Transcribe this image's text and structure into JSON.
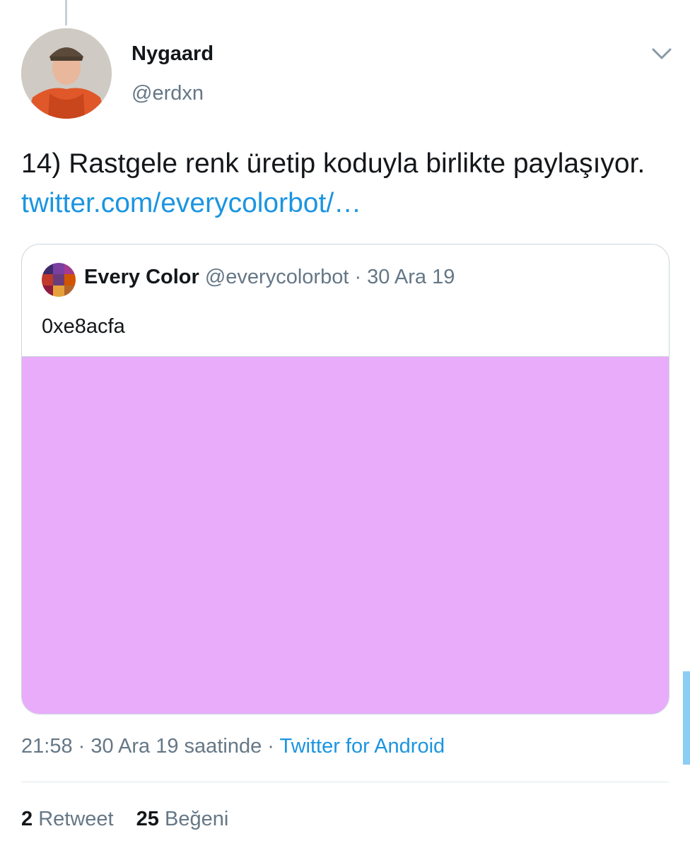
{
  "tweet": {
    "author": {
      "display_name": "Nygaard",
      "handle": "@erdxn"
    },
    "text": "14) Rastgele renk üretip koduyla birlikte paylaşıyor.",
    "link_text": "twitter.com/everycolorbot/…",
    "timestamp": "21:58 · 30 Ara 19 saatinde",
    "separator": " · ",
    "source": "Twitter for Android",
    "stats": {
      "retweet_count": "2",
      "retweet_label": "Retweet",
      "like_count": "25",
      "like_label": "Beğeni"
    }
  },
  "quote": {
    "author_name": "Every Color",
    "handle": "@everycolorbot",
    "date": "30 Ara 19",
    "dot": " · ",
    "text": "0xe8acfa",
    "media_color": "#e8acfa"
  },
  "icons": {
    "menu": "chevron-down-icon",
    "avatar": "avatar-image",
    "quote_avatar": "color-grid-avatar"
  },
  "colors": {
    "link": "#1b95e0",
    "secondary_text": "#657786",
    "primary_text": "#14171a",
    "border": "#ccd6dd"
  }
}
